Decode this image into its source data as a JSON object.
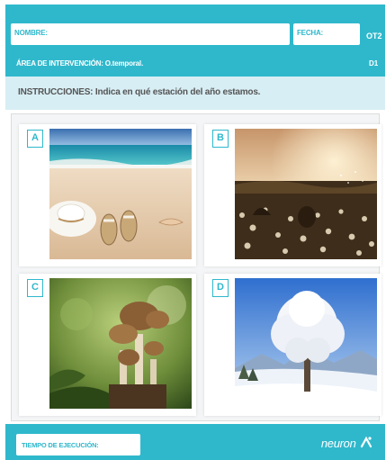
{
  "header": {
    "name_label": "NOMBRE:",
    "date_label": "FECHA:",
    "code_top": "OT2",
    "area_label": "ÁREA DE INTERVENCIÓN: O.temporal.",
    "code_bottom": "D1"
  },
  "instructions": "INSTRUCCIONES: Indica en qué estación del año estamos.",
  "options": [
    {
      "letter": "A",
      "image": "beach-summer-photo"
    },
    {
      "letter": "B",
      "image": "dandelion-field-spring-photo"
    },
    {
      "letter": "C",
      "image": "mushrooms-autumn-photo"
    },
    {
      "letter": "D",
      "image": "snowy-tree-winter-photo"
    }
  ],
  "footer": {
    "time_label": "TIEMPO DE EJECUCIÓN:",
    "logo_text": "neuron"
  },
  "colors": {
    "primary": "#2fb8cc",
    "instructions_bg": "#d7eef4"
  }
}
